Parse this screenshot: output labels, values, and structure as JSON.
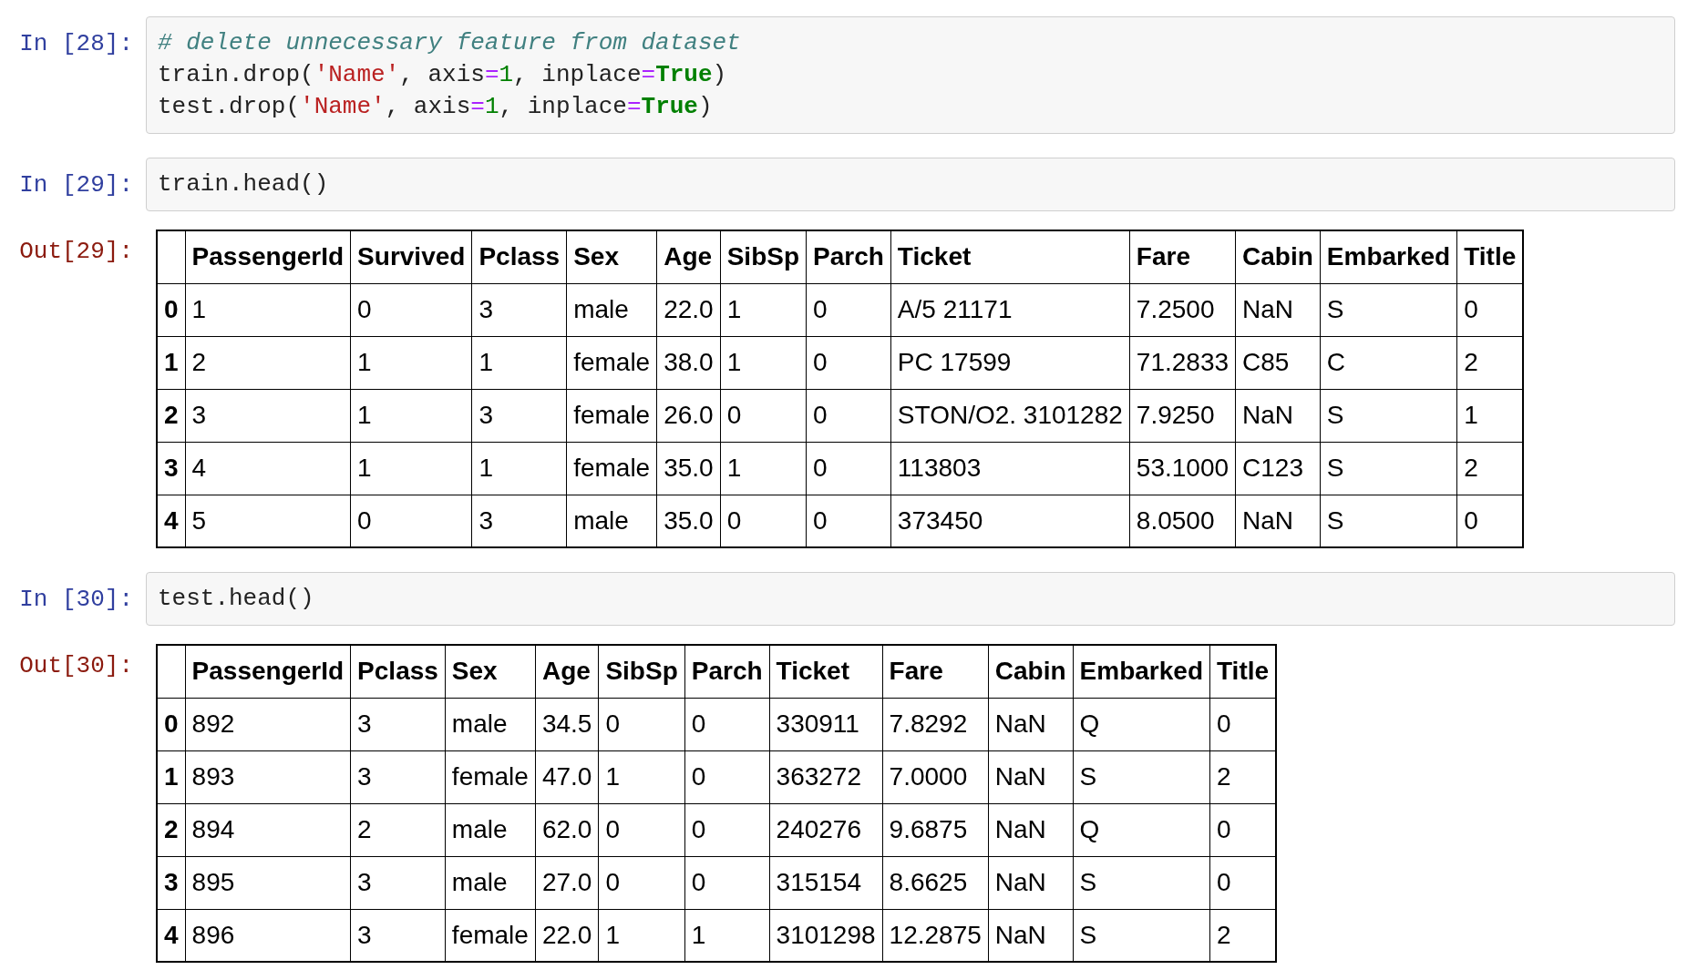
{
  "cells": [
    {
      "input": {
        "prompt": "In [28]:",
        "lines": [
          [
            {
              "kind": "comment",
              "text": "# delete unnecessary feature from dataset"
            }
          ],
          [
            {
              "kind": "plain",
              "text": "train.drop("
            },
            {
              "kind": "string",
              "text": "'Name'"
            },
            {
              "kind": "plain",
              "text": ", axis"
            },
            {
              "kind": "operator",
              "text": "="
            },
            {
              "kind": "number",
              "text": "1"
            },
            {
              "kind": "plain",
              "text": ", inplace"
            },
            {
              "kind": "operator",
              "text": "="
            },
            {
              "kind": "keyword",
              "text": "True"
            },
            {
              "kind": "plain",
              "text": ")"
            }
          ],
          [
            {
              "kind": "plain",
              "text": "test.drop("
            },
            {
              "kind": "string",
              "text": "'Name'"
            },
            {
              "kind": "plain",
              "text": ", axis"
            },
            {
              "kind": "operator",
              "text": "="
            },
            {
              "kind": "number",
              "text": "1"
            },
            {
              "kind": "plain",
              "text": ", inplace"
            },
            {
              "kind": "operator",
              "text": "="
            },
            {
              "kind": "keyword",
              "text": "True"
            },
            {
              "kind": "plain",
              "text": ")"
            }
          ]
        ]
      }
    },
    {
      "input": {
        "prompt": "In [29]:",
        "lines": [
          [
            {
              "kind": "plain",
              "text": "train.head()"
            }
          ]
        ]
      },
      "output": {
        "prompt": "Out[29]:",
        "table": {
          "columns": [
            "PassengerId",
            "Survived",
            "Pclass",
            "Sex",
            "Age",
            "SibSp",
            "Parch",
            "Ticket",
            "Fare",
            "Cabin",
            "Embarked",
            "Title"
          ],
          "rows": [
            {
              "index": "0",
              "cells": [
                "1",
                "0",
                "3",
                "male",
                "22.0",
                "1",
                "0",
                "A/5 21171",
                "7.2500",
                "NaN",
                "S",
                "0"
              ]
            },
            {
              "index": "1",
              "cells": [
                "2",
                "1",
                "1",
                "female",
                "38.0",
                "1",
                "0",
                "PC 17599",
                "71.2833",
                "C85",
                "C",
                "2"
              ]
            },
            {
              "index": "2",
              "cells": [
                "3",
                "1",
                "3",
                "female",
                "26.0",
                "0",
                "0",
                "STON/O2. 3101282",
                "7.9250",
                "NaN",
                "S",
                "1"
              ]
            },
            {
              "index": "3",
              "cells": [
                "4",
                "1",
                "1",
                "female",
                "35.0",
                "1",
                "0",
                "113803",
                "53.1000",
                "C123",
                "S",
                "2"
              ]
            },
            {
              "index": "4",
              "cells": [
                "5",
                "0",
                "3",
                "male",
                "35.0",
                "0",
                "0",
                "373450",
                "8.0500",
                "NaN",
                "S",
                "0"
              ]
            }
          ]
        }
      }
    },
    {
      "input": {
        "prompt": "In [30]:",
        "lines": [
          [
            {
              "kind": "plain",
              "text": "test.head()"
            }
          ]
        ]
      },
      "output": {
        "prompt": "Out[30]:",
        "table": {
          "columns": [
            "PassengerId",
            "Pclass",
            "Sex",
            "Age",
            "SibSp",
            "Parch",
            "Ticket",
            "Fare",
            "Cabin",
            "Embarked",
            "Title"
          ],
          "rows": [
            {
              "index": "0",
              "cells": [
                "892",
                "3",
                "male",
                "34.5",
                "0",
                "0",
                "330911",
                "7.8292",
                "NaN",
                "Q",
                "0"
              ]
            },
            {
              "index": "1",
              "cells": [
                "893",
                "3",
                "female",
                "47.0",
                "1",
                "0",
                "363272",
                "7.0000",
                "NaN",
                "S",
                "2"
              ]
            },
            {
              "index": "2",
              "cells": [
                "894",
                "2",
                "male",
                "62.0",
                "0",
                "0",
                "240276",
                "9.6875",
                "NaN",
                "Q",
                "0"
              ]
            },
            {
              "index": "3",
              "cells": [
                "895",
                "3",
                "male",
                "27.0",
                "0",
                "0",
                "315154",
                "8.6625",
                "NaN",
                "S",
                "0"
              ]
            },
            {
              "index": "4",
              "cells": [
                "896",
                "3",
                "female",
                "22.0",
                "1",
                "1",
                "3101298",
                "12.2875",
                "NaN",
                "S",
                "2"
              ]
            }
          ]
        }
      }
    }
  ]
}
